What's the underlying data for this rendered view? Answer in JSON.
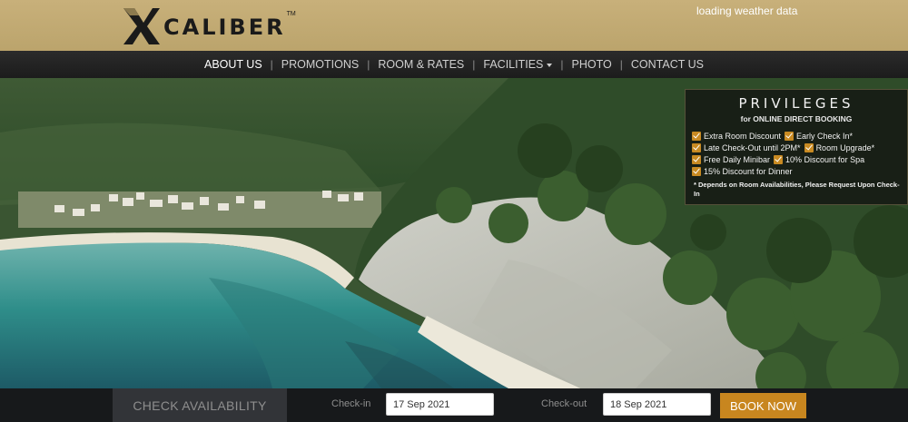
{
  "header": {
    "brand": "CALIBER",
    "trademark": "TM",
    "weather": "loading weather data"
  },
  "nav": {
    "items": [
      {
        "label": "ABOUT US"
      },
      {
        "label": "PROMOTIONS"
      },
      {
        "label": "ROOM & RATES"
      },
      {
        "label": "FACILITIES"
      },
      {
        "label": "PHOTO"
      },
      {
        "label": "CONTACT US"
      }
    ],
    "separator": "|"
  },
  "privileges": {
    "title": "PRIVILEGES",
    "subtitle": "for ONLINE DIRECT BOOKING",
    "items": [
      "Extra Room Discount",
      "Early Check In*",
      "Late Check-Out until 2PM*",
      "Room Upgrade*",
      "Free Daily Minibar",
      "10% Discount for Spa",
      "15% Discount for Dinner"
    ],
    "note": "* Depends on Room Availabilities, Please Request Upon Check-In"
  },
  "booking": {
    "title": "CHECK AVAILABILITY",
    "checkin_label": "Check-in",
    "checkin_value": "17 Sep 2021",
    "checkout_label": "Check-out",
    "checkout_value": "18 Sep 2021",
    "button": "BOOK NOW"
  },
  "colors": {
    "header_gold": "#c8b07a",
    "accent_orange": "#c8861f",
    "nav_dark": "#222222"
  }
}
